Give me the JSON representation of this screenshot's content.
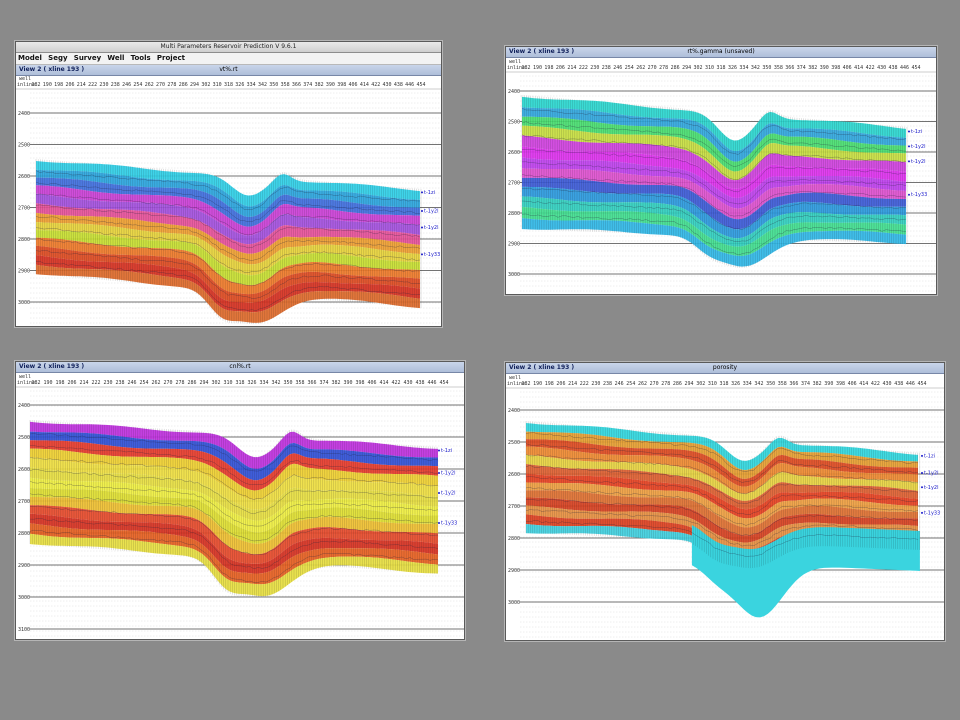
{
  "app": {
    "title": "Multi Parameters Reservoir Prediction V 9.6.1",
    "menu": [
      "Model",
      "Segy",
      "Survey",
      "Well",
      "Tools",
      "Project"
    ]
  },
  "common": {
    "well_label": "well",
    "inline_label": "inline",
    "xlabels": [
      "182",
      "190",
      "198",
      "206",
      "214",
      "222",
      "230",
      "238",
      "246",
      "254",
      "262",
      "270",
      "278",
      "286",
      "294",
      "302",
      "310",
      "318",
      "326",
      "334",
      "342",
      "350",
      "358",
      "366",
      "374",
      "382",
      "390",
      "398",
      "406",
      "414",
      "422",
      "430",
      "438",
      "446",
      "454"
    ]
  },
  "colors": {
    "background": "#8a8a8a",
    "titlebar": "#b9c7e0",
    "horizon_label": "#1b1bcc"
  },
  "panels": [
    {
      "view": "View 2 ( xline 193 )",
      "title": "vt%.rt",
      "palette": "vt",
      "yticks": [
        "2400",
        "2500",
        "2600",
        "2700",
        "2800",
        "2900",
        "3000",
        "3100"
      ],
      "horizons": [
        "t-1zi",
        "t-1y2l",
        "t-1y2l",
        "t-1y33"
      ]
    },
    {
      "view": "View 2 ( xline 193 )",
      "title": "rt%.gamma (unsaved)",
      "palette": "gamma",
      "yticks": [
        "2400",
        "2500",
        "2600",
        "2700",
        "2800",
        "2900",
        "3000"
      ],
      "horizons": [
        "t-1zi",
        "t-1y2l",
        "t-1y2l",
        "t-1y33"
      ]
    },
    {
      "view": "View 2 ( xline 193 )",
      "title": "cnl%.rt",
      "palette": "cnl",
      "yticks": [
        "2400",
        "2500",
        "2600",
        "2700",
        "2800",
        "2900",
        "3000",
        "3100"
      ],
      "horizons": [
        "t-1zi",
        "t-1y2l",
        "t-1y2l",
        "t-1y33"
      ]
    },
    {
      "view": "View 2 ( xline 193 )",
      "title": "porosity",
      "palette": "poro",
      "yticks": [
        "2400",
        "2500",
        "2600",
        "2700",
        "2800",
        "2900",
        "3000"
      ],
      "horizons": [
        "t-1zi",
        "t-1y2l",
        "t-1y2l",
        "t-1y33"
      ]
    }
  ]
}
